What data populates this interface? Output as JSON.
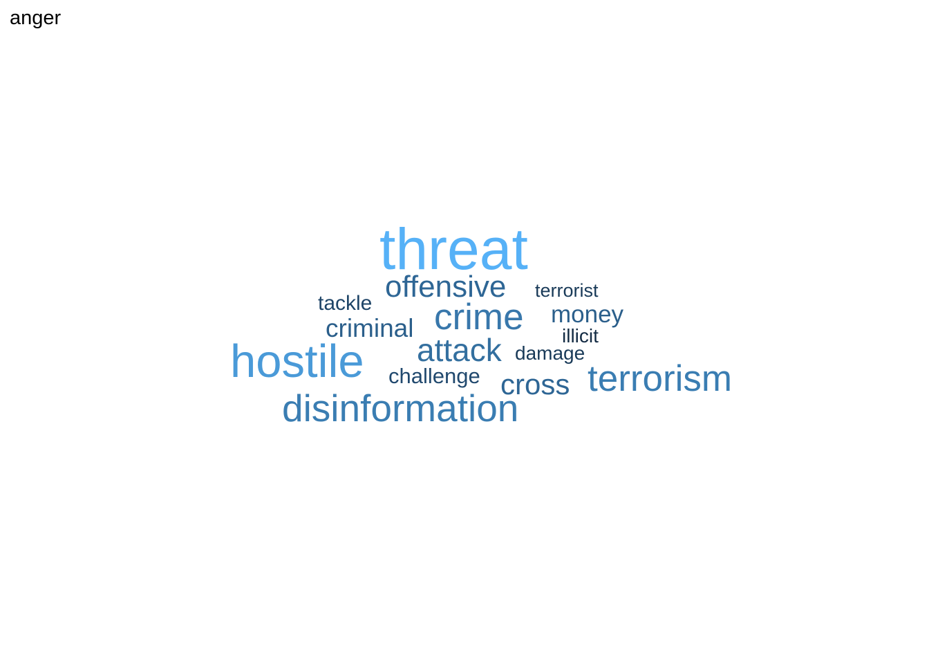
{
  "title": "anger",
  "words": {
    "threat": {
      "text": "threat",
      "color": "#56B1F7"
    },
    "hostile": {
      "text": "hostile",
      "color": "#4A9AD8"
    },
    "terrorism": {
      "text": "terrorism",
      "color": "#3A7DB2"
    },
    "disinformation": {
      "text": "disinformation",
      "color": "#3A7DB2"
    },
    "crime": {
      "text": "crime",
      "color": "#3877AB"
    },
    "offensive": {
      "text": "offensive",
      "color": "#2E6695"
    },
    "attack": {
      "text": "attack",
      "color": "#336F9F"
    },
    "cross": {
      "text": "cross",
      "color": "#2E6695"
    },
    "criminal": {
      "text": "criminal",
      "color": "#2B5F8B"
    },
    "money": {
      "text": "money",
      "color": "#2B5F8B"
    },
    "challenge": {
      "text": "challenge",
      "color": "#21496E"
    },
    "tackle": {
      "text": "tackle",
      "color": "#1E4467"
    },
    "terrorist": {
      "text": "terrorist",
      "color": "#193A58"
    },
    "damage": {
      "text": "damage",
      "color": "#193A58"
    },
    "illicit": {
      "text": "illicit",
      "color": "#132B43"
    }
  }
}
